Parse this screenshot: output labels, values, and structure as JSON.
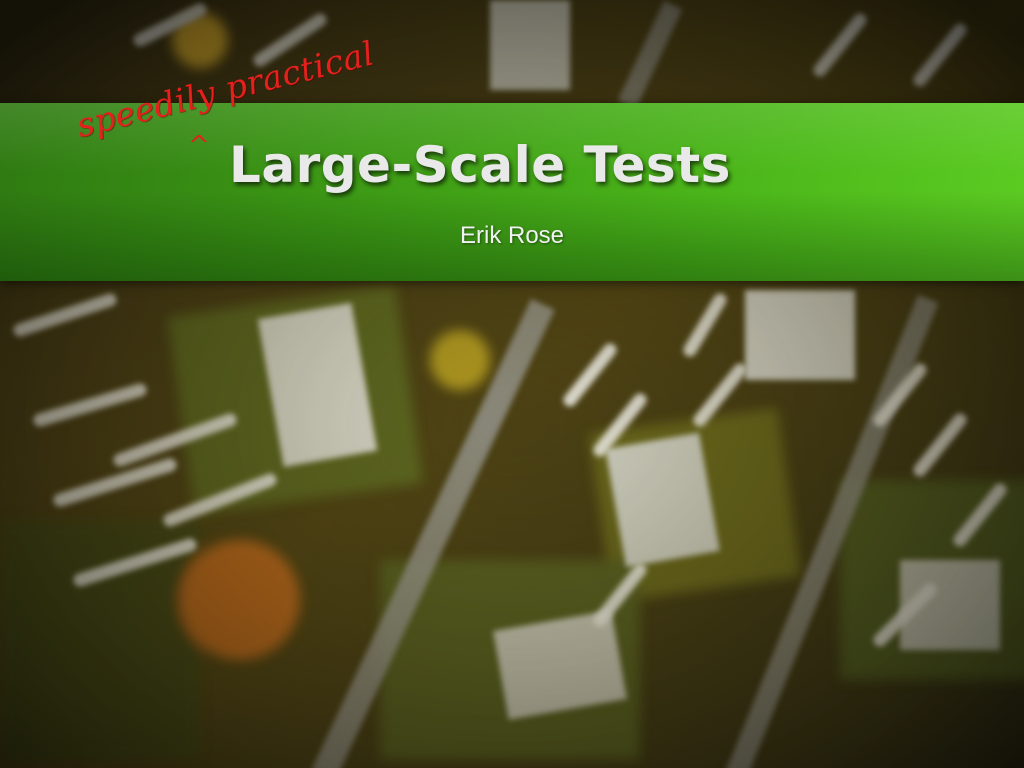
{
  "slide": {
    "title": "Large-Scale Tests",
    "annotation": "speedily practical",
    "insertion_mark": "^",
    "author": "Erik Rose",
    "background": "photo of green circuit boards with white connectors and mosaic labels",
    "colors": {
      "band": "#3d9a15",
      "annotation": "#e5201d",
      "title": "#e9e9e9"
    }
  }
}
